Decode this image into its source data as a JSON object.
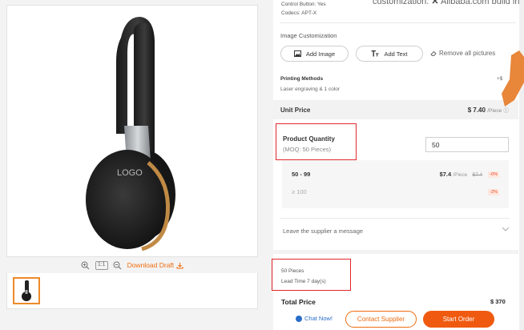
{
  "preview": {
    "logo_text": "LOGO",
    "download_label": "Download Draft",
    "ratio_label": "1:1"
  },
  "specs": {
    "control_button": "Control Button: Yes",
    "codecs": "Codecs: APT-X"
  },
  "overlay": {
    "text_left": "customization.",
    "text_right": "Alibaba.com build in e"
  },
  "image_customization": {
    "title": "Image Customization",
    "add_image": "Add Image",
    "add_text": "Add Text",
    "remove_all": "Remove all pictures"
  },
  "printing": {
    "title": "Printing Methods",
    "value": "Laser engraving & 1 color",
    "extra": "+$"
  },
  "unit_price": {
    "label": "Unit Price",
    "value": "$ 7.40",
    "per": "/Piece"
  },
  "quantity": {
    "title": "Product Quantity",
    "moq": "(MOQ: 50 Pieces)",
    "input_value": "50"
  },
  "tiers": [
    {
      "range": "50 - 99",
      "price": "$7.4",
      "per": "/Piece",
      "old": "$7.4",
      "badge": "-0%"
    },
    {
      "range": "≥ 100",
      "badge": "-2%"
    }
  ],
  "message": {
    "label": "Leave the supplier a message"
  },
  "summary": {
    "pieces": "50 Pieces",
    "lead_time": "Lead Time 7 day(s)"
  },
  "total": {
    "label": "Total Price",
    "value": "$ 370"
  },
  "actions": {
    "chat_now": "Chat Now!",
    "contact_supplier": "Contact Supplier",
    "start_order": "Start Order"
  },
  "colors": {
    "accent_orange": "#ef6c10",
    "highlight_red": "#e0272c",
    "link_blue": "#2a6dc9",
    "headphone_band": "#c08a45"
  }
}
